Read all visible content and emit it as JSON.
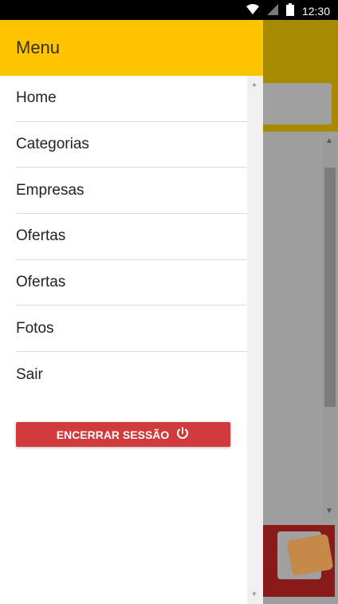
{
  "status_bar": {
    "time": "12:30"
  },
  "drawer": {
    "title": "Menu",
    "items": [
      {
        "label": "Home"
      },
      {
        "label": "Categorias"
      },
      {
        "label": "Empresas"
      },
      {
        "label": "Ofertas"
      },
      {
        "label": "Ofertas"
      },
      {
        "label": "Fotos"
      },
      {
        "label": "Sair"
      }
    ],
    "logout_label": "ENCERRAR SESSÃO"
  },
  "colors": {
    "drawer_header": "#ffc400",
    "logout_button": "#d23b3b",
    "dimmed_appbar": "#a88a00"
  }
}
